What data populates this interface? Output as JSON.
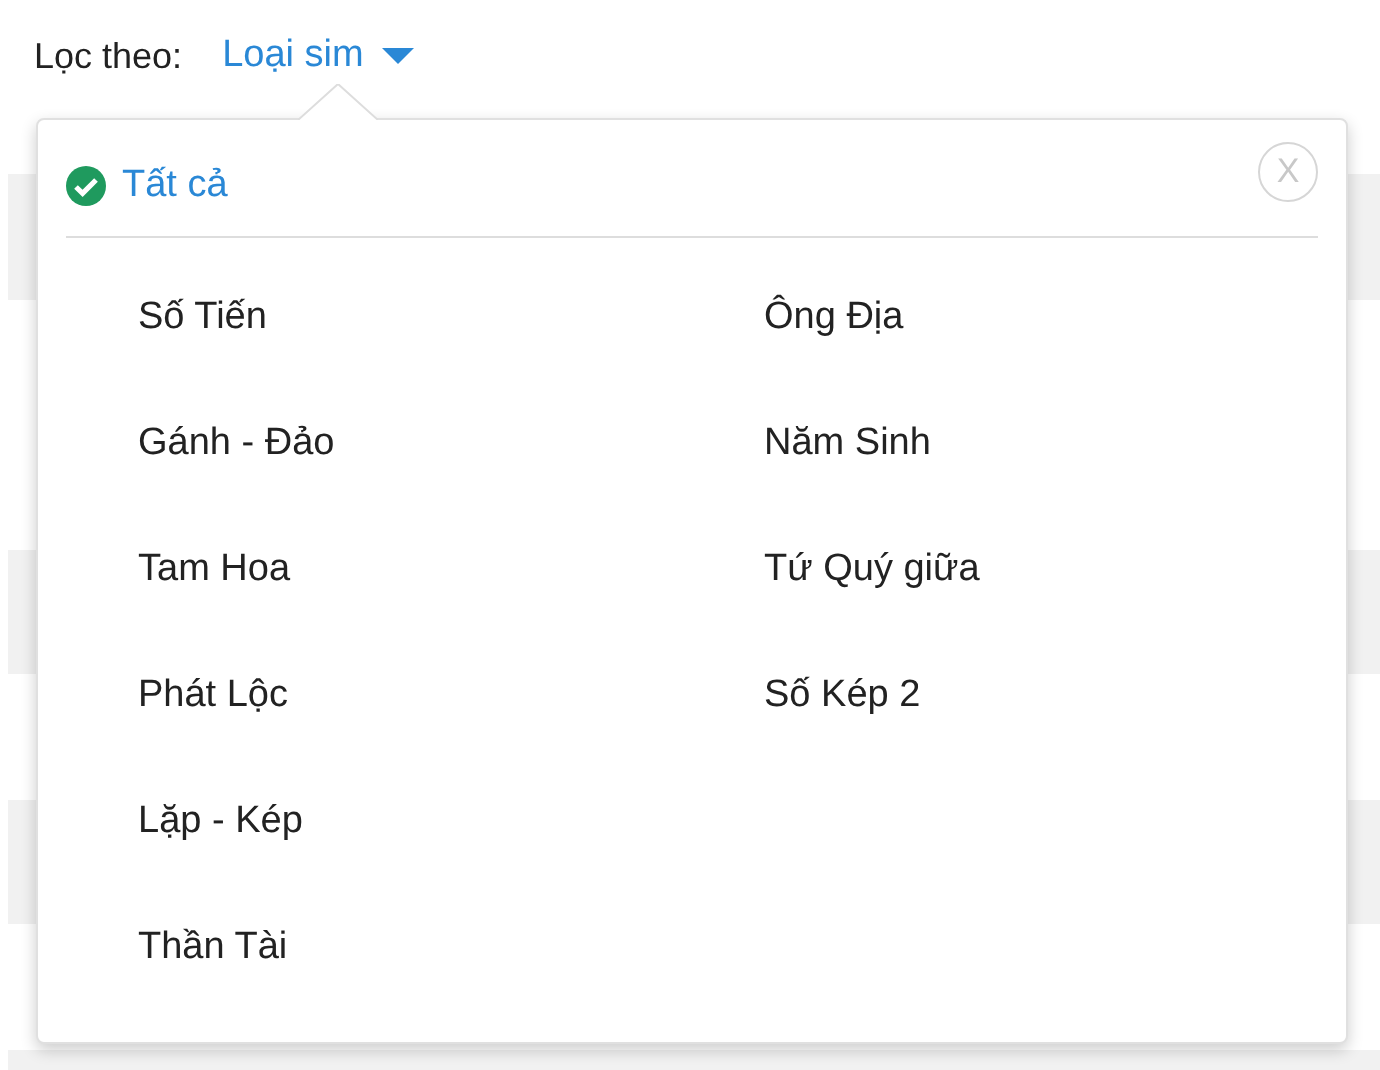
{
  "filter": {
    "label": "Lọc theo:",
    "dropdown": "Loại sim"
  },
  "popup": {
    "all_option": {
      "label": "Tất cả",
      "selected": true
    },
    "close": "X",
    "columns": [
      [
        {
          "label": "Số Tiến",
          "selected": false
        },
        {
          "label": "Gánh - Đảo",
          "selected": false
        },
        {
          "label": "Tam Hoa",
          "selected": false
        },
        {
          "label": "Phát Lộc",
          "selected": false
        },
        {
          "label": "Lặp - Kép",
          "selected": false
        },
        {
          "label": "Thần Tài",
          "selected": false
        }
      ],
      [
        {
          "label": "Ông Địa",
          "selected": false
        },
        {
          "label": "Năm Sinh",
          "selected": false
        },
        {
          "label": "Tứ Quý giữa",
          "selected": false
        },
        {
          "label": "Số Kép 2",
          "selected": false
        }
      ]
    ]
  }
}
